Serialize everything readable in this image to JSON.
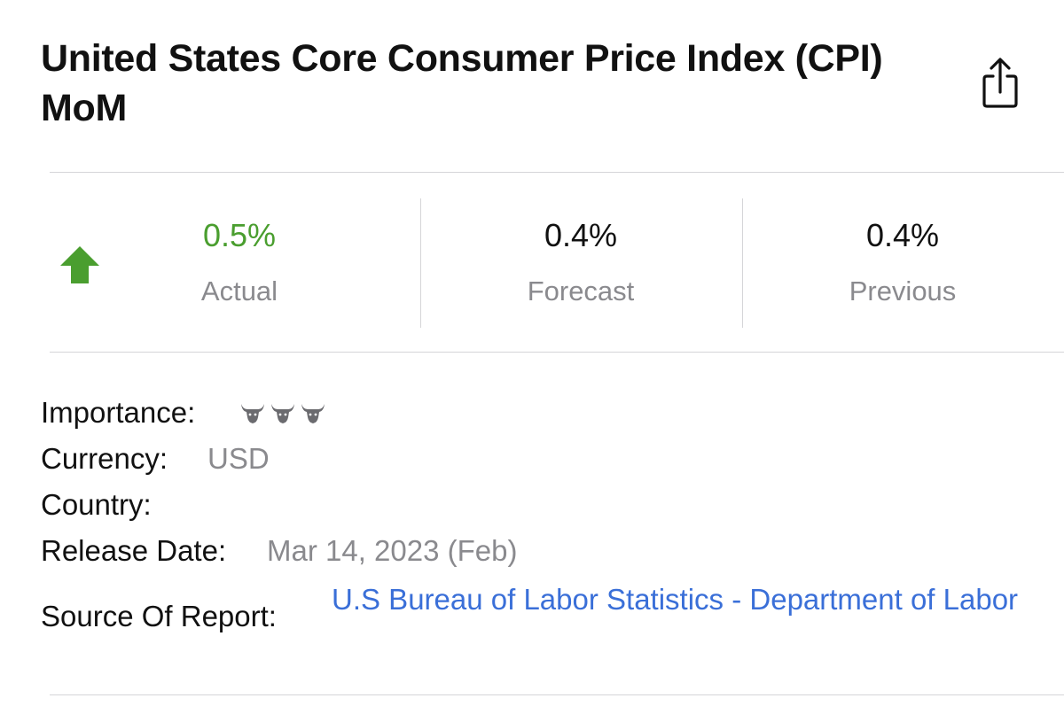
{
  "header": {
    "title": "United States Core Consumer Price Index (CPI) MoM",
    "share_icon": "share-icon"
  },
  "stats": {
    "trend_icon": "arrow-up-icon",
    "trend_color": "#4a9e2f",
    "actual": {
      "value": "0.5%",
      "label": "Actual"
    },
    "forecast": {
      "value": "0.4%",
      "label": "Forecast"
    },
    "previous": {
      "value": "0.4%",
      "label": "Previous"
    }
  },
  "details": {
    "importance": {
      "label": "Importance:",
      "level": 3,
      "max": 3,
      "icon": "bull-icon"
    },
    "currency": {
      "label": "Currency:",
      "value": "USD"
    },
    "country": {
      "label": "Country:"
    },
    "release_date": {
      "label": "Release Date:",
      "value": "Mar 14, 2023 (Feb)"
    },
    "source": {
      "label": "Source Of Report:",
      "value": "U.S Bureau of Labor Statistics - Department of Labor"
    }
  },
  "colors": {
    "accent_green": "#4a9e2f",
    "link_blue": "#3a6fd8",
    "muted_gray": "#8a8a8e"
  }
}
